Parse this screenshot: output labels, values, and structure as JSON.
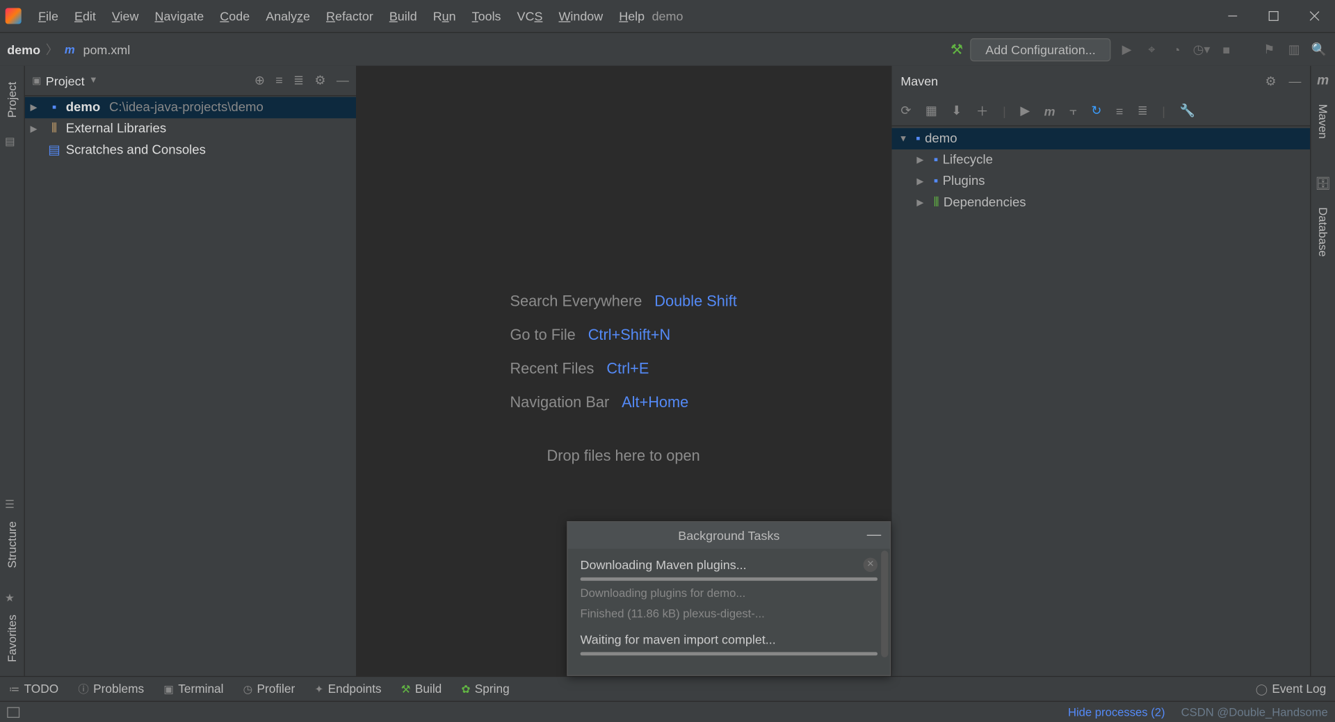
{
  "titlebar": {
    "menus": [
      "File",
      "Edit",
      "View",
      "Navigate",
      "Code",
      "Analyze",
      "Refactor",
      "Build",
      "Run",
      "Tools",
      "VCS",
      "Window",
      "Help"
    ],
    "title": "demo"
  },
  "toolbar": {
    "breadcrumb_project": "demo",
    "breadcrumb_file": "pom.xml",
    "add_config": "Add Configuration..."
  },
  "left_gutter": {
    "project": "Project",
    "structure": "Structure",
    "favorites": "Favorites"
  },
  "project_panel": {
    "title": "Project",
    "root_name": "demo",
    "root_path": "C:\\idea-java-projects\\demo",
    "ext_lib": "External Libraries",
    "scratches": "Scratches and Consoles"
  },
  "editor_hints": {
    "r1_label": "Search Everywhere",
    "r1_keys": "Double Shift",
    "r2_label": "Go to File",
    "r2_keys": "Ctrl+Shift+N",
    "r3_label": "Recent Files",
    "r3_keys": "Ctrl+E",
    "r4_label": "Navigation Bar",
    "r4_keys": "Alt+Home",
    "drop": "Drop files here to open"
  },
  "bg_tasks": {
    "header": "Background Tasks",
    "t1_title": "Downloading Maven plugins...",
    "t1_sub1": "Downloading plugins for demo...",
    "t1_sub2": "Finished (11.86 kB) plexus-digest-...",
    "t2_title": "Waiting for maven import complet..."
  },
  "maven": {
    "title": "Maven",
    "root": "demo",
    "n1": "Lifecycle",
    "n2": "Plugins",
    "n3": "Dependencies"
  },
  "right_gutter": {
    "maven": "Maven",
    "database": "Database"
  },
  "bottom_bar": {
    "todo": "TODO",
    "problems": "Problems",
    "terminal": "Terminal",
    "profiler": "Profiler",
    "endpoints": "Endpoints",
    "build": "Build",
    "spring": "Spring",
    "event_log": "Event Log"
  },
  "status_bar": {
    "hide": "Hide processes (2)",
    "watermark": "CSDN @Double_Handsome"
  }
}
